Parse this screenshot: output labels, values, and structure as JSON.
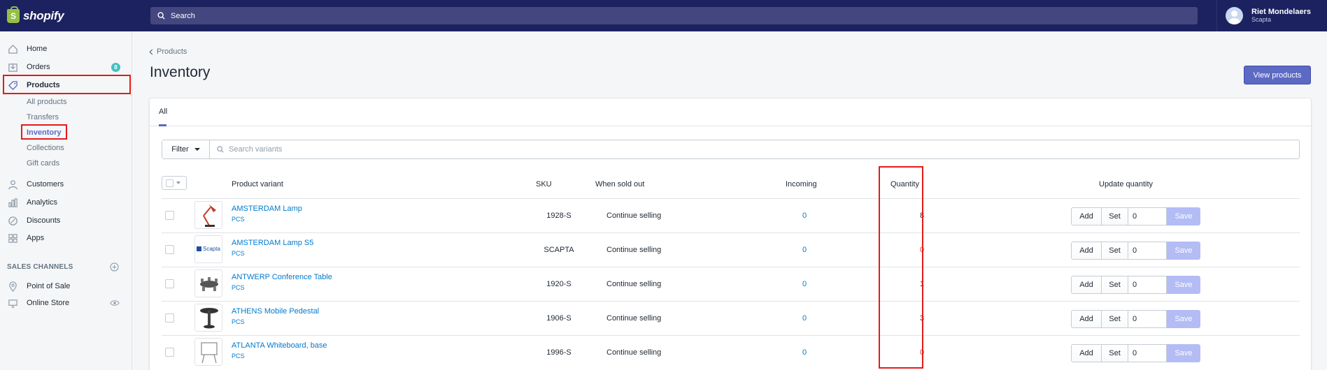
{
  "app": {
    "logo_text": "shopify",
    "logo_letter": "S"
  },
  "search": {
    "placeholder": "Search"
  },
  "user": {
    "name": "Riet Mondelaers",
    "store": "Scapta"
  },
  "sidebar": {
    "items": [
      {
        "label": "Home",
        "icon": "home-icon"
      },
      {
        "label": "Orders",
        "icon": "orders-icon",
        "badge": "8"
      },
      {
        "label": "Products",
        "icon": "tag-icon"
      },
      {
        "label": "Customers",
        "icon": "customers-icon"
      },
      {
        "label": "Analytics",
        "icon": "analytics-icon"
      },
      {
        "label": "Discounts",
        "icon": "discounts-icon"
      },
      {
        "label": "Apps",
        "icon": "apps-icon"
      }
    ],
    "product_subitems": [
      "All products",
      "Transfers",
      "Inventory",
      "Collections",
      "Gift cards"
    ],
    "sales_channels_label": "SALES CHANNELS",
    "channels": [
      {
        "label": "Point of Sale",
        "icon": "location-icon"
      },
      {
        "label": "Online Store",
        "icon": "store-icon"
      }
    ]
  },
  "page": {
    "breadcrumb": "Products",
    "title": "Inventory",
    "primary_action": "View products"
  },
  "tabs": [
    "All"
  ],
  "filter": {
    "button_label": "Filter",
    "search_placeholder": "Search variants"
  },
  "table": {
    "headers": {
      "variant": "Product variant",
      "sku": "SKU",
      "sold_out": "When sold out",
      "incoming": "Incoming",
      "quantity": "Quantity",
      "update": "Update quantity"
    },
    "rows": [
      {
        "name": "AMSTERDAM Lamp",
        "unit": "PCS",
        "sku": "1928-S",
        "sold_out": "Continue selling",
        "incoming": "0",
        "quantity": "8",
        "input": "0"
      },
      {
        "name": "AMSTERDAM Lamp S5",
        "unit": "PCS",
        "sku": "SCAPTA",
        "sold_out": "Continue selling",
        "incoming": "0",
        "quantity": "0",
        "input": "0"
      },
      {
        "name": "ANTWERP Conference Table",
        "unit": "PCS",
        "sku": "1920-S",
        "sold_out": "Continue selling",
        "incoming": "0",
        "quantity": "1",
        "input": "0"
      },
      {
        "name": "ATHENS Mobile Pedestal",
        "unit": "PCS",
        "sku": "1906-S",
        "sold_out": "Continue selling",
        "incoming": "0",
        "quantity": "3",
        "input": "0"
      },
      {
        "name": "ATLANTA Whiteboard, base",
        "unit": "PCS",
        "sku": "1996-S",
        "sold_out": "Continue selling",
        "incoming": "0",
        "quantity": "0",
        "input": "0"
      }
    ],
    "row_actions": {
      "add": "Add",
      "set": "Set",
      "save": "Save"
    }
  },
  "thumb_text": {
    "scapta": "Scapta"
  },
  "colors": {
    "topbar": "#1c2260",
    "accent": "#5c6ac4",
    "link": "#007ace",
    "zero_qty": "#de3618",
    "highlight": "#e21b1b"
  }
}
